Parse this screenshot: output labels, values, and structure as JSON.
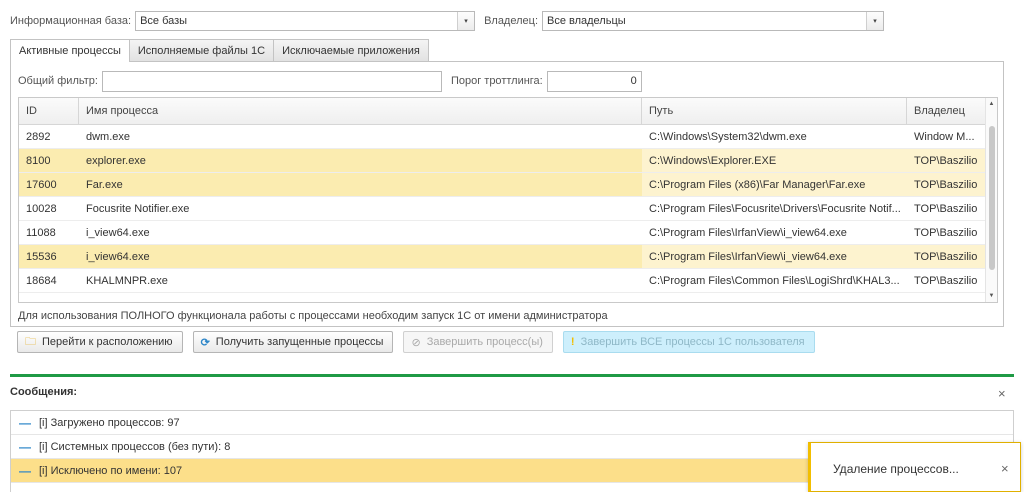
{
  "filters": {
    "infobase_label": "Информационная база:",
    "infobase_value": "Все базы",
    "owner_label": "Владелец:",
    "owner_value": "Все владельцы"
  },
  "tabs": [
    {
      "label": "Активные процессы",
      "active": true
    },
    {
      "label": "Исполняемые файлы 1С",
      "active": false
    },
    {
      "label": "Исключаемые приложения",
      "active": false
    }
  ],
  "panel": {
    "general_filter_label": "Общий фильтр:",
    "general_filter_value": "",
    "throttle_label": "Порог троттлинга:",
    "throttle_value": "0"
  },
  "grid": {
    "columns": [
      "ID",
      "Имя процесса",
      "Путь",
      "Владелец"
    ],
    "rows": [
      {
        "id": "2892",
        "name": "dwm.exe",
        "path": "C:\\Windows\\System32\\dwm.exe",
        "owner": "Window M...",
        "highlight": false
      },
      {
        "id": "8100",
        "name": "explorer.exe",
        "path": "C:\\Windows\\Explorer.EXE",
        "owner": "TOP\\Baszilio",
        "highlight": true
      },
      {
        "id": "17600",
        "name": "Far.exe",
        "path": "C:\\Program Files (x86)\\Far Manager\\Far.exe",
        "owner": "TOP\\Baszilio",
        "highlight": true
      },
      {
        "id": "10028",
        "name": "Focusrite Notifier.exe",
        "path": "C:\\Program Files\\Focusrite\\Drivers\\Focusrite Notif...",
        "owner": "TOP\\Baszilio",
        "highlight": false
      },
      {
        "id": "11088",
        "name": "i_view64.exe",
        "path": "C:\\Program Files\\IrfanView\\i_view64.exe",
        "owner": "TOP\\Baszilio",
        "highlight": false
      },
      {
        "id": "15536",
        "name": "i_view64.exe",
        "path": "C:\\Program Files\\IrfanView\\i_view64.exe",
        "owner": "TOP\\Baszilio",
        "highlight": true
      },
      {
        "id": "18684",
        "name": "KHALMNPR.exe",
        "path": "C:\\Program Files\\Common Files\\LogiShrd\\KHAL3...",
        "owner": "TOP\\Baszilio",
        "highlight": false
      }
    ]
  },
  "note": "Для использования ПОЛНОГО функционала работы с процессами необходим запуск 1С от имени администратора",
  "buttons": {
    "goto_location": "Перейти к расположению",
    "get_processes": "Получить запущенные процессы",
    "terminate": "Завершить процесс(ы)",
    "terminate_all": "Завершить ВСЕ процессы 1С пользователя"
  },
  "messages": {
    "title": "Сообщения:",
    "items": [
      {
        "text": "[i] Загружено процессов: 97",
        "highlight": false
      },
      {
        "text": "[i] Системных процессов (без пути): 8",
        "highlight": false
      },
      {
        "text": "[i] Исключено по имени: 107",
        "highlight": true
      }
    ]
  },
  "toast": {
    "text": "Удаление процессов..."
  },
  "colors": {
    "accent_green": "#1f9a45",
    "row_highlight": "#fbecb0",
    "message_highlight": "#fcdf8a",
    "toast_border": "#f2be00"
  }
}
